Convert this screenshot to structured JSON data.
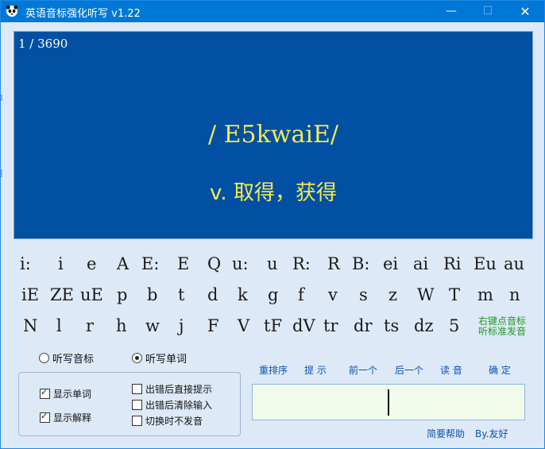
{
  "window": {
    "title": "英语音标强化听写 v1.22",
    "minimize": "—",
    "maximize": "☐",
    "close": "✕"
  },
  "display": {
    "counter": "1 / 3690",
    "phonetic": "/ E5kwaiE/",
    "meaning": "v. 取得，获得"
  },
  "symbols": {
    "row1": [
      "i:",
      "i",
      "e",
      "A",
      "E:",
      "E",
      "Q",
      "u:",
      "u",
      "R:",
      "R",
      "B:",
      "ei",
      "ai",
      "Ri",
      "Eu",
      "au"
    ],
    "row2": [
      "iE",
      "ZE",
      "uE",
      "p",
      "b",
      "t",
      "d",
      "k",
      "g",
      "f",
      "v",
      "s",
      "z",
      "W",
      "T",
      "m",
      "n"
    ],
    "row3": [
      "N",
      "l",
      "r",
      "h",
      "w",
      "j",
      "F",
      "V",
      "tF",
      "dV",
      "tr",
      "dr",
      "ts",
      "dz",
      "5"
    ]
  },
  "hint": {
    "line1": "右键点音标",
    "line2": "听标准发音"
  },
  "modes": {
    "phonetic_label": "听写音标",
    "word_label": "听写单词",
    "selected": "word"
  },
  "options": {
    "show_word": {
      "label": "显示单词",
      "checked": true
    },
    "show_meaning": {
      "label": "显示解释",
      "checked": true
    },
    "hint_on_error": {
      "label": "出错后直接提示",
      "checked": false
    },
    "clear_on_error": {
      "label": "出错后清除输入",
      "checked": false
    },
    "mute_on_switch": {
      "label": "切换时不发音",
      "checked": false
    }
  },
  "actions": {
    "reorder": "重排序",
    "hint": "提 示",
    "prev": "前一个",
    "next": "后一个",
    "read": "读 音",
    "confirm": "确 定"
  },
  "input": {
    "value": ""
  },
  "footer": {
    "help": "简要帮助",
    "author": "By.友好"
  },
  "colors": {
    "display_bg": "#0250a4",
    "display_text": "#f4ea55",
    "titlebar": "#0078d7",
    "input_bg": "#f1fbe9",
    "link": "#0b52b8",
    "hint": "#1f9a1f"
  }
}
